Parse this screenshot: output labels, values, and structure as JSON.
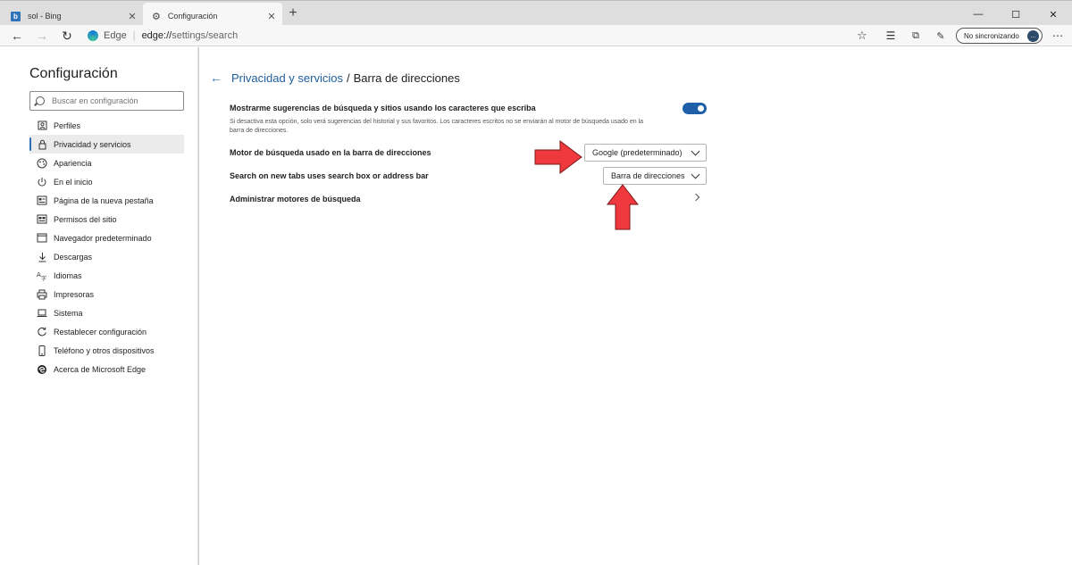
{
  "tabs": [
    {
      "title": "sol - Bing",
      "icon": "bing-icon"
    },
    {
      "title": "Configuración",
      "icon": "gear-icon"
    }
  ],
  "toolbar": {
    "site_label": "Edge",
    "url_host": "edge://",
    "url_path": "settings/search",
    "profile_label": "No sincronizando",
    "avatar_text": "..."
  },
  "sidebar": {
    "title": "Configuración",
    "search_placeholder": "Buscar en configuración",
    "items": [
      {
        "label": "Perfiles",
        "icon": "person-icon"
      },
      {
        "label": "Privacidad y servicios",
        "icon": "lock-icon",
        "active": true
      },
      {
        "label": "Apariencia",
        "icon": "palette-icon"
      },
      {
        "label": "En el inicio",
        "icon": "power-icon"
      },
      {
        "label": "Página de la nueva pestaña",
        "icon": "new-tab-icon"
      },
      {
        "label": "Permisos del sitio",
        "icon": "site-permissions-icon"
      },
      {
        "label": "Navegador predeterminado",
        "icon": "browser-icon"
      },
      {
        "label": "Descargas",
        "icon": "download-icon"
      },
      {
        "label": "Idiomas",
        "icon": "language-icon"
      },
      {
        "label": "Impresoras",
        "icon": "printer-icon"
      },
      {
        "label": "Sistema",
        "icon": "laptop-icon"
      },
      {
        "label": "Restablecer configuración",
        "icon": "reset-icon"
      },
      {
        "label": "Teléfono y otros dispositivos",
        "icon": "phone-icon"
      },
      {
        "label": "Acerca de Microsoft Edge",
        "icon": "edge-icon"
      }
    ]
  },
  "main": {
    "breadcrumb_parent": "Privacidad y servicios",
    "breadcrumb_separator": "/",
    "breadcrumb_current": "Barra de direcciones",
    "suggestions": {
      "title": "Mostrarme sugerencias de búsqueda y sitios usando los caracteres que escriba",
      "description": "Si desactiva esta opción, solo verá sugerencias del historial y sus favoritos. Los caracteres escritos no se enviarán al motor de búsqueda usado en la barra de direcciones.",
      "enabled": true
    },
    "engine": {
      "title": "Motor de búsqueda usado en la barra de direcciones",
      "value": "Google (predeterminado)"
    },
    "newtab_search": {
      "title": "Search on new tabs uses search box or address bar",
      "value": "Barra de direcciones"
    },
    "manage": {
      "title": "Administrar motores de búsqueda"
    }
  },
  "colors": {
    "accent": "#1f5fa8",
    "annotation": "#f0393f"
  }
}
